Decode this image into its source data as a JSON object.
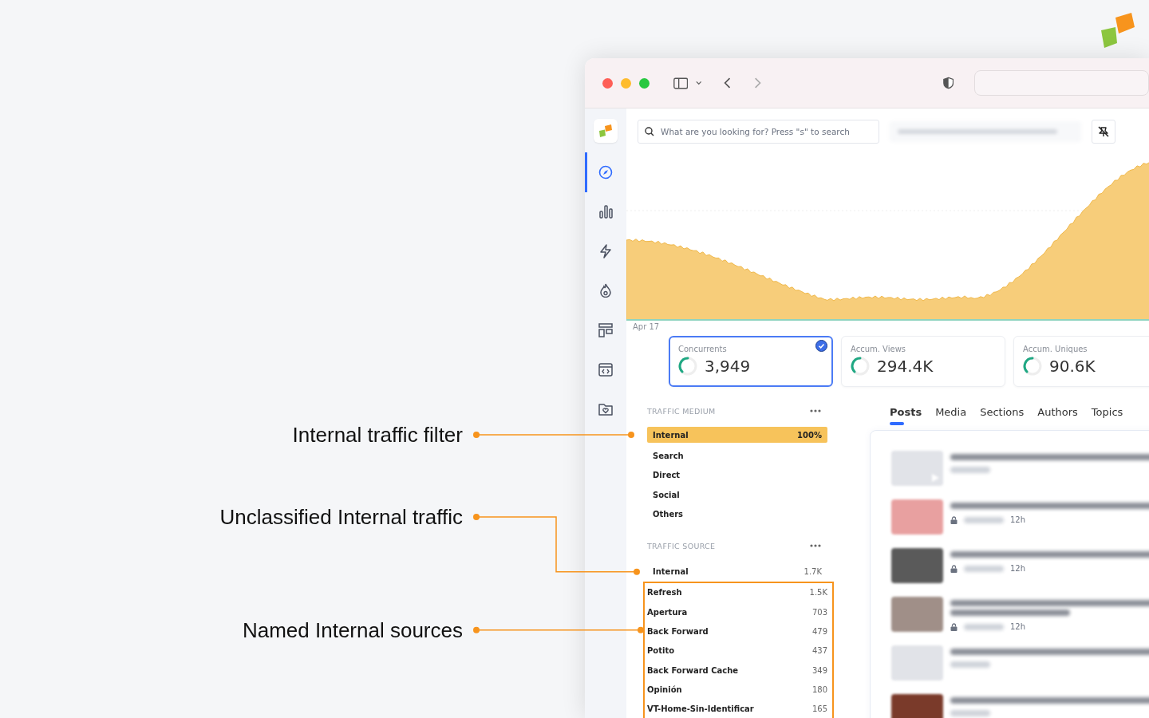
{
  "callouts": [
    {
      "label": "Internal traffic filter"
    },
    {
      "label": "Unclassified Internal traffic"
    },
    {
      "label": "Named Internal sources"
    }
  ],
  "browser": {
    "back_enabled": true,
    "forward_enabled": false
  },
  "search": {
    "placeholder": "What are you looking for? Press \"s\" to search"
  },
  "sidebar": {
    "items": [
      {
        "kind": "compass",
        "selected": true
      },
      {
        "kind": "bars",
        "selected": false
      },
      {
        "kind": "bolt",
        "selected": false
      },
      {
        "kind": "flame",
        "selected": false
      },
      {
        "kind": "layout",
        "selected": false
      },
      {
        "kind": "calendar",
        "selected": false
      },
      {
        "kind": "folder",
        "selected": false
      }
    ]
  },
  "chart": {
    "date_label": "Apr 17"
  },
  "kpis": [
    {
      "label": "Concurrents",
      "value": "3,949",
      "selected": true
    },
    {
      "label": "Accum. Views",
      "value": "294.4K",
      "selected": false
    },
    {
      "label": "Accum. Uniques",
      "value": "90.6K",
      "selected": false
    }
  ],
  "traffic_medium": {
    "title": "TRAFFIC MEDIUM",
    "items": [
      {
        "label": "Internal",
        "value": "100%",
        "selected": true
      },
      {
        "label": "Search",
        "selected": false
      },
      {
        "label": "Direct",
        "selected": false
      },
      {
        "label": "Social",
        "selected": false
      },
      {
        "label": "Others",
        "selected": false
      }
    ]
  },
  "traffic_source": {
    "title": "TRAFFIC SOURCE",
    "items": [
      {
        "label": "Internal",
        "value": "1.7K",
        "boxed": false
      },
      {
        "label": "Refresh",
        "value": "1.5K",
        "boxed": true
      },
      {
        "label": "Apertura",
        "value": "703",
        "boxed": true
      },
      {
        "label": "Back Forward",
        "value": "479",
        "boxed": true
      },
      {
        "label": "Potito",
        "value": "437",
        "boxed": true
      },
      {
        "label": "Back Forward Cache",
        "value": "349",
        "boxed": true
      },
      {
        "label": "Opinión",
        "value": "180",
        "boxed": true
      },
      {
        "label": "VT-Home-Sin-Identificar",
        "value": "165",
        "boxed": true
      }
    ]
  },
  "tabs": [
    {
      "label": "Posts",
      "selected": true
    },
    {
      "label": "Media",
      "selected": false
    },
    {
      "label": "Sections",
      "selected": false
    },
    {
      "label": "Authors",
      "selected": false
    },
    {
      "label": "Topics",
      "selected": false
    }
  ],
  "posts": [
    {
      "kind": "video",
      "locked": false,
      "wrapped": false
    },
    {
      "kind": "image",
      "locked": true,
      "time": "12h",
      "wrapped": false,
      "color": "#e8a0a0"
    },
    {
      "kind": "image",
      "locked": true,
      "time": "12h",
      "wrapped": false,
      "color": "#5a5a5a"
    },
    {
      "kind": "image",
      "locked": true,
      "time": "12h",
      "wrapped": true,
      "color": "#a08f88"
    },
    {
      "kind": "blank",
      "locked": false,
      "wrapped": false
    },
    {
      "kind": "image",
      "locked": false,
      "wrapped": false,
      "color": "#7a3a2a"
    }
  ]
}
